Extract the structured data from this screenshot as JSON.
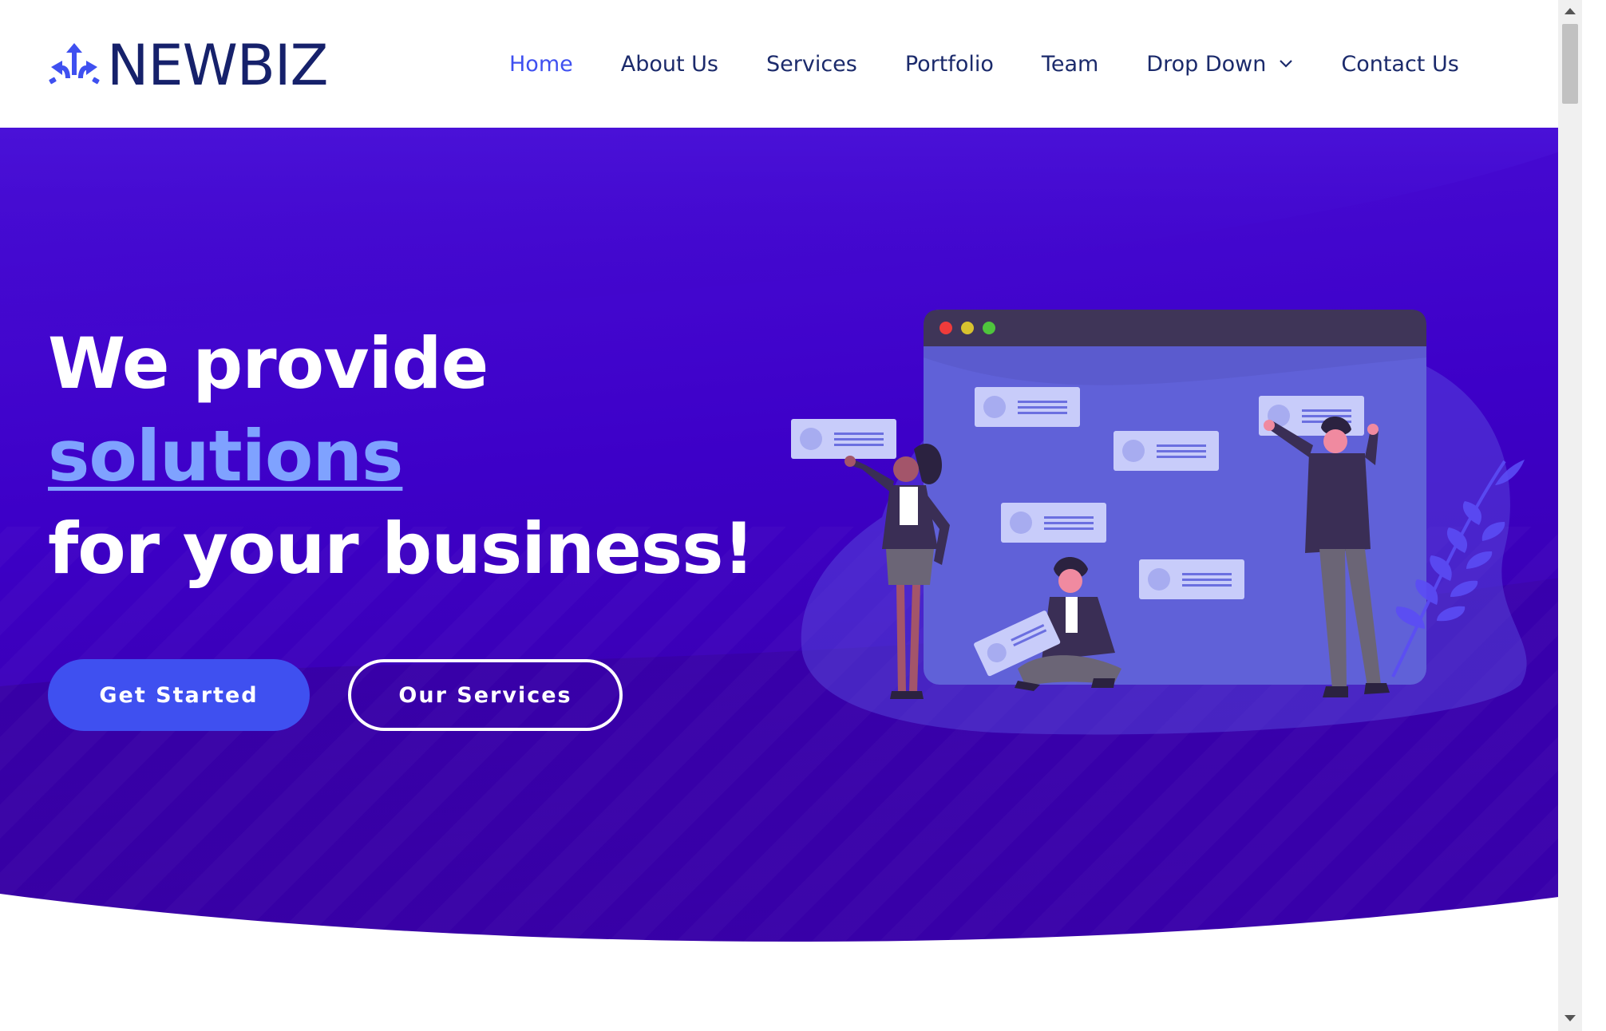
{
  "brand": {
    "name": "NEWBIZ",
    "color": "#16216b",
    "accent": "#3f50f0"
  },
  "nav": {
    "items": [
      {
        "label": "Home",
        "active": true
      },
      {
        "label": "About Us"
      },
      {
        "label": "Services"
      },
      {
        "label": "Portfolio"
      },
      {
        "label": "Team"
      },
      {
        "label": "Drop Down",
        "has_dropdown": true
      },
      {
        "label": "Contact Us"
      }
    ]
  },
  "hero": {
    "line1": "We provide",
    "accent_word": "solutions",
    "line3": "for your business!",
    "primary_button": "Get Started",
    "secondary_button": "Our Services",
    "background_color": "#3d00c8",
    "accent_text_color": "#7fa2ff"
  },
  "icons": {
    "logo": "arrows-split-icon",
    "dropdown": "chevron-down-icon"
  }
}
